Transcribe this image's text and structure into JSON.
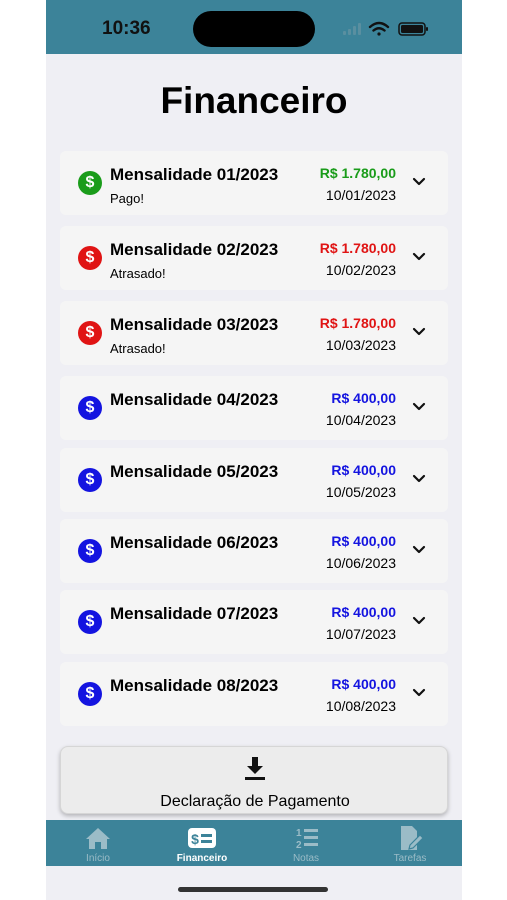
{
  "status_bar": {
    "time": "10:36"
  },
  "page_title": "Financeiro",
  "colors": {
    "paid": "#1a9c1a",
    "late": "#e01414",
    "open": "#1414e0",
    "tabbar": "#3c8399"
  },
  "payments": [
    {
      "title": "Mensalidade 01/2023",
      "status": "Pago!",
      "amount": "R$ 1.780,00",
      "date": "10/01/2023",
      "state": "paid"
    },
    {
      "title": "Mensalidade 02/2023",
      "status": "Atrasado!",
      "amount": "R$ 1.780,00",
      "date": "10/02/2023",
      "state": "late"
    },
    {
      "title": "Mensalidade 03/2023",
      "status": "Atrasado!",
      "amount": "R$ 1.780,00",
      "date": "10/03/2023",
      "state": "late"
    },
    {
      "title": "Mensalidade 04/2023",
      "status": "",
      "amount": "R$ 400,00",
      "date": "10/04/2023",
      "state": "open"
    },
    {
      "title": "Mensalidade 05/2023",
      "status": "",
      "amount": "R$ 400,00",
      "date": "10/05/2023",
      "state": "open"
    },
    {
      "title": "Mensalidade 06/2023",
      "status": "",
      "amount": "R$ 400,00",
      "date": "10/06/2023",
      "state": "open"
    },
    {
      "title": "Mensalidade 07/2023",
      "status": "",
      "amount": "R$ 400,00",
      "date": "10/07/2023",
      "state": "open"
    },
    {
      "title": "Mensalidade 08/2023",
      "status": "",
      "amount": "R$ 400,00",
      "date": "10/08/2023",
      "state": "open"
    }
  ],
  "download_button": {
    "label": "Declaração de Pagamento",
    "icon": "download-icon"
  },
  "tabs": [
    {
      "label": "Início",
      "icon": "home-icon",
      "active": false
    },
    {
      "label": "Financeiro",
      "icon": "dollar-card-icon",
      "active": true
    },
    {
      "label": "Notas",
      "icon": "numbered-list-icon",
      "active": false
    },
    {
      "label": "Tarefas",
      "icon": "document-edit-icon",
      "active": false
    }
  ]
}
